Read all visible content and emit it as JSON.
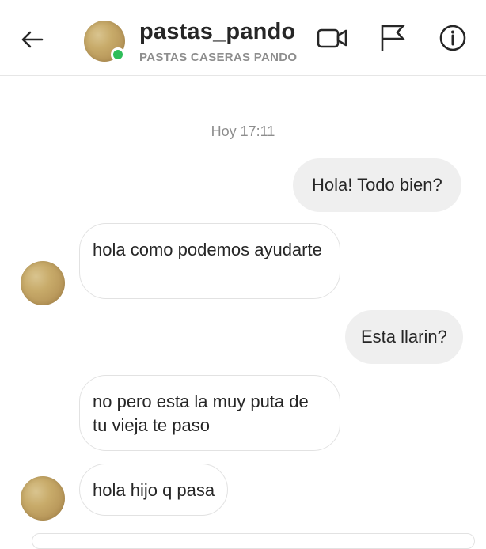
{
  "header": {
    "username": "pastas_pando",
    "subtitle": "PASTAS CASERAS PANDO",
    "icons": [
      "back-arrow-icon",
      "avatar",
      "video-call-icon",
      "flag-icon",
      "info-icon"
    ],
    "online_color": "#2ebd59"
  },
  "chat": {
    "timestamp": "Hoy 17:11",
    "messages": [
      {
        "from": "me",
        "text": "Hola! Todo bien?"
      },
      {
        "from": "them",
        "text": "hola como podemos ayudarte"
      },
      {
        "from": "me",
        "text": "Esta llarin?"
      },
      {
        "from": "them",
        "text": "no pero esta la muy puta de tu vieja te paso"
      },
      {
        "from": "them",
        "text": "hola hijo q pasa"
      }
    ]
  },
  "colors": {
    "outgoing_bubble": "#efefef",
    "incoming_border": "#e2e2e2",
    "secondary_text": "#8e8e8e"
  }
}
